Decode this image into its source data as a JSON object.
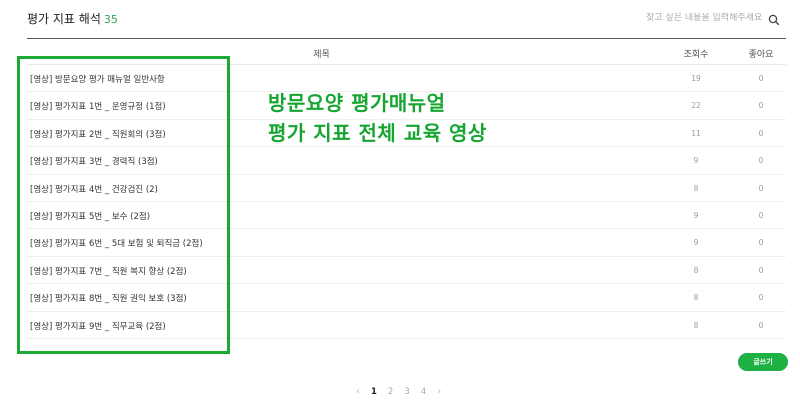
{
  "board": {
    "title": "평가 지표 해석",
    "count": "35"
  },
  "search": {
    "placeholder": "찾고 싶은 내용을 입력해주세요"
  },
  "columns": {
    "title": "제목",
    "views": "조회수",
    "likes": "좋아요"
  },
  "rows": [
    {
      "title": "[영상] 방문요양 평가 매뉴얼 일반사항",
      "views": "19",
      "likes": "0"
    },
    {
      "title": "[영상] 평가지표 1번 _ 운영규정 (1점)",
      "views": "22",
      "likes": "0"
    },
    {
      "title": "[영상] 평가지표 2번 _ 직원회의 (3점)",
      "views": "11",
      "likes": "0"
    },
    {
      "title": "[영상] 평가지표 3번 _ 경력직 (3점)",
      "views": "9",
      "likes": "0"
    },
    {
      "title": "[영상] 평가지표 4번 _ 건강검진 (2)",
      "views": "8",
      "likes": "0"
    },
    {
      "title": "[영상] 평가지표 5번 _ 보수 (2점)",
      "views": "9",
      "likes": "0"
    },
    {
      "title": "[영상] 평가지표 6번 _ 5대 보험 및 퇴직금 (2점)",
      "views": "9",
      "likes": "0"
    },
    {
      "title": "[영상] 평가지표 7번 _ 직원 복지 향상 (2점)",
      "views": "8",
      "likes": "0"
    },
    {
      "title": "[영상] 평가지표 8번 _ 직원 권익 보호 (3점)",
      "views": "8",
      "likes": "0"
    },
    {
      "title": "[영상] 평가지표 9번 _ 직무교육 (2점)",
      "views": "8",
      "likes": "0"
    }
  ],
  "overlay": {
    "line1": "방문요양 평가매뉴얼",
    "line2": "평가 지표 전체 교육 영상"
  },
  "write_button": "글쓰기",
  "pagination": {
    "prev": "‹",
    "pages": [
      "1",
      "2",
      "3",
      "4"
    ],
    "current": "1",
    "next": "›"
  },
  "colors": {
    "accent": "#1db043",
    "highlight": "#1bab35",
    "overlay_text": "#17a532"
  },
  "icons": {
    "search": "search-icon",
    "prev": "chevron-left-icon",
    "next": "chevron-right-icon"
  }
}
